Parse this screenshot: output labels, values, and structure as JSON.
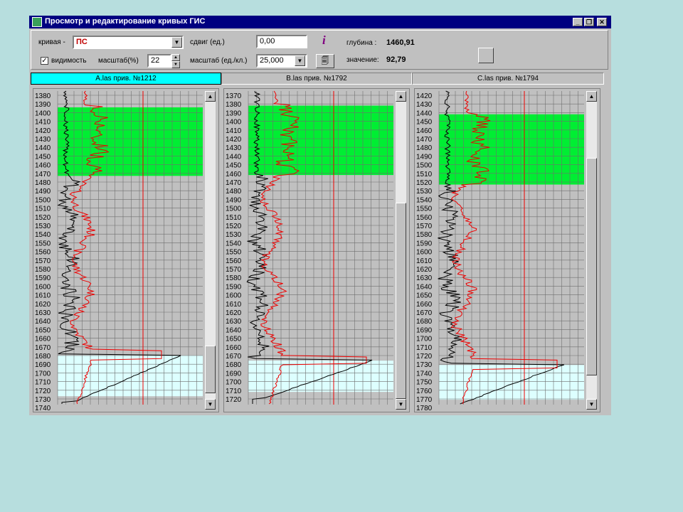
{
  "window": {
    "title": "Просмотр и редактирование кривых ГИС",
    "controls": [
      "_",
      "❐",
      "✕"
    ]
  },
  "toolbar": {
    "curve_label": "кривая -",
    "curve_value": "ПС",
    "visibility_label": "видимость",
    "visibility_checked": true,
    "scale_pct_label": "масштаб(%)",
    "scale_pct_value": "22",
    "shift_label": "сдвиг (ед.)",
    "shift_value": "0,00",
    "scale_units_label": "масштаб (ед./кл.)",
    "scale_units_value": "25,000",
    "info_icon_glyph": "i",
    "depth_label": "глубина :",
    "depth_value": "1460,91",
    "value_label": "значение:",
    "value_value": "92,79",
    "colors": {
      "curve_value": "#c00000",
      "info_icon": "#800080"
    }
  },
  "tabs": [
    {
      "label": "A.las прив.  №1212",
      "active": true
    },
    {
      "label": "B.las прив.  №1792",
      "active": false
    },
    {
      "label": "C.las прив.  №1794",
      "active": false
    }
  ],
  "colors": {
    "reservoir_zone": "#00ee33",
    "lower_zone": "#ddffff",
    "grid": "#6f6f6f",
    "panel_bg": "#c0c0c0",
    "curve_black": "#000000",
    "curve_red": "#ee0000",
    "active_tab": "#00ffff"
  },
  "panels": [
    {
      "name": "panel-a",
      "depth_labels": [
        1380,
        1390,
        1400,
        1410,
        1420,
        1430,
        1440,
        1450,
        1460,
        1470,
        1480,
        1490,
        1500,
        1510,
        1520,
        1530,
        1540,
        1550,
        1560,
        1570,
        1580,
        1590,
        1600,
        1610,
        1620,
        1630,
        1640,
        1650,
        1660,
        1670,
        1680,
        1690,
        1700,
        1710,
        1720,
        1730,
        1740
      ],
      "green_zone_depth": [
        1398,
        1477
      ],
      "cyan_zone_depth": [
        1684,
        1731
      ],
      "scroll_thumb_fraction": [
        0.82,
        0.98
      ]
    },
    {
      "name": "panel-b",
      "depth_labels": [
        1370,
        1380,
        1390,
        1400,
        1410,
        1420,
        1430,
        1440,
        1450,
        1460,
        1470,
        1480,
        1490,
        1500,
        1510,
        1520,
        1530,
        1540,
        1550,
        1560,
        1570,
        1580,
        1590,
        1600,
        1610,
        1620,
        1630,
        1640,
        1650,
        1660,
        1670,
        1680,
        1690,
        1700,
        1710,
        1720
      ],
      "green_zone_depth": [
        1386,
        1466
      ],
      "cyan_zone_depth": [
        1680,
        1716
      ],
      "scroll_thumb_fraction": [
        0.34,
        1.0
      ]
    },
    {
      "name": "panel-c",
      "depth_labels": [
        1420,
        1430,
        1440,
        1450,
        1460,
        1470,
        1480,
        1490,
        1500,
        1510,
        1520,
        1530,
        1540,
        1550,
        1560,
        1570,
        1580,
        1590,
        1600,
        1610,
        1620,
        1630,
        1640,
        1650,
        1660,
        1670,
        1680,
        1690,
        1700,
        1710,
        1720,
        1730,
        1740,
        1750,
        1760,
        1770,
        1780
      ],
      "green_zone_depth": [
        1446,
        1527
      ],
      "cyan_zone_depth": [
        1735,
        1775
      ],
      "scroll_thumb_fraction": [
        0.19,
        0.92
      ]
    }
  ]
}
